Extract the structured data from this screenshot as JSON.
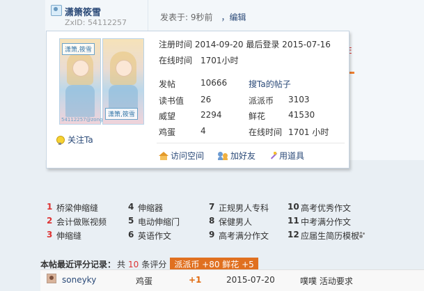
{
  "post": {
    "author": "潇箫筱雪",
    "zxid": "ZxID: 54112257",
    "posted": "发表于: 9秒前",
    "edit": "，编辑",
    "partial_text": "E"
  },
  "profile_card": {
    "photo_stamp": "潇箫,筱雪",
    "photo_corner": "54112257@zongxi",
    "follow_label": "关注Ta",
    "register_line": "注册时间 2014-09-20 最后登录 2015-07-16",
    "online_line": "在线时间　1701小时",
    "ta_posts_link": "搜Ta的帖子",
    "stats": {
      "posts_label": "发帖",
      "posts_value": "10666",
      "read_label": "读书值",
      "read_value": "26",
      "paipai_label": "派派币",
      "paipai_value": "3103",
      "prestige_label": "威望",
      "prestige_value": "2294",
      "flowers_label": "鲜花",
      "flowers_value": "41530",
      "egg_label": "鸡蛋",
      "egg_value": "4",
      "online_label": "在线时间",
      "online_value": "1701 小时"
    },
    "actions": {
      "visit": "访问空间",
      "add_friend": "加好友",
      "use_item": "用道具"
    }
  },
  "related": [
    {
      "idx": "1",
      "label": "桥梁伸缩缝"
    },
    {
      "idx": "2",
      "label": "会计做账视频"
    },
    {
      "idx": "3",
      "label": "伸缩缝"
    },
    {
      "idx": "4",
      "label": "伸缩器"
    },
    {
      "idx": "5",
      "label": "电动伸缩门"
    },
    {
      "idx": "6",
      "label": "英语作文"
    },
    {
      "idx": "7",
      "label": "正规男人专科"
    },
    {
      "idx": "8",
      "label": "保健男人"
    },
    {
      "idx": "9",
      "label": "高考满分作文"
    },
    {
      "idx": "10",
      "label": "高考优秀作文"
    },
    {
      "idx": "11",
      "label": "中考满分作文"
    },
    {
      "idx": "12",
      "label": "应届生简历模板"
    }
  ],
  "ratings": {
    "title": "本帖最近评分记录：",
    "prefix": "共",
    "count": "10",
    "suffix": "条评分",
    "summary": "派派币 +80 鲜花 +5",
    "entries": [
      {
        "user": "soneyky",
        "item": "鸡蛋",
        "score": "+1",
        "date": "2015-07-20",
        "reason": "噗噗 活动要求"
      }
    ]
  },
  "colors": {
    "link": "#2b4a78",
    "accent": "#d33333",
    "badge": "#e07020"
  }
}
